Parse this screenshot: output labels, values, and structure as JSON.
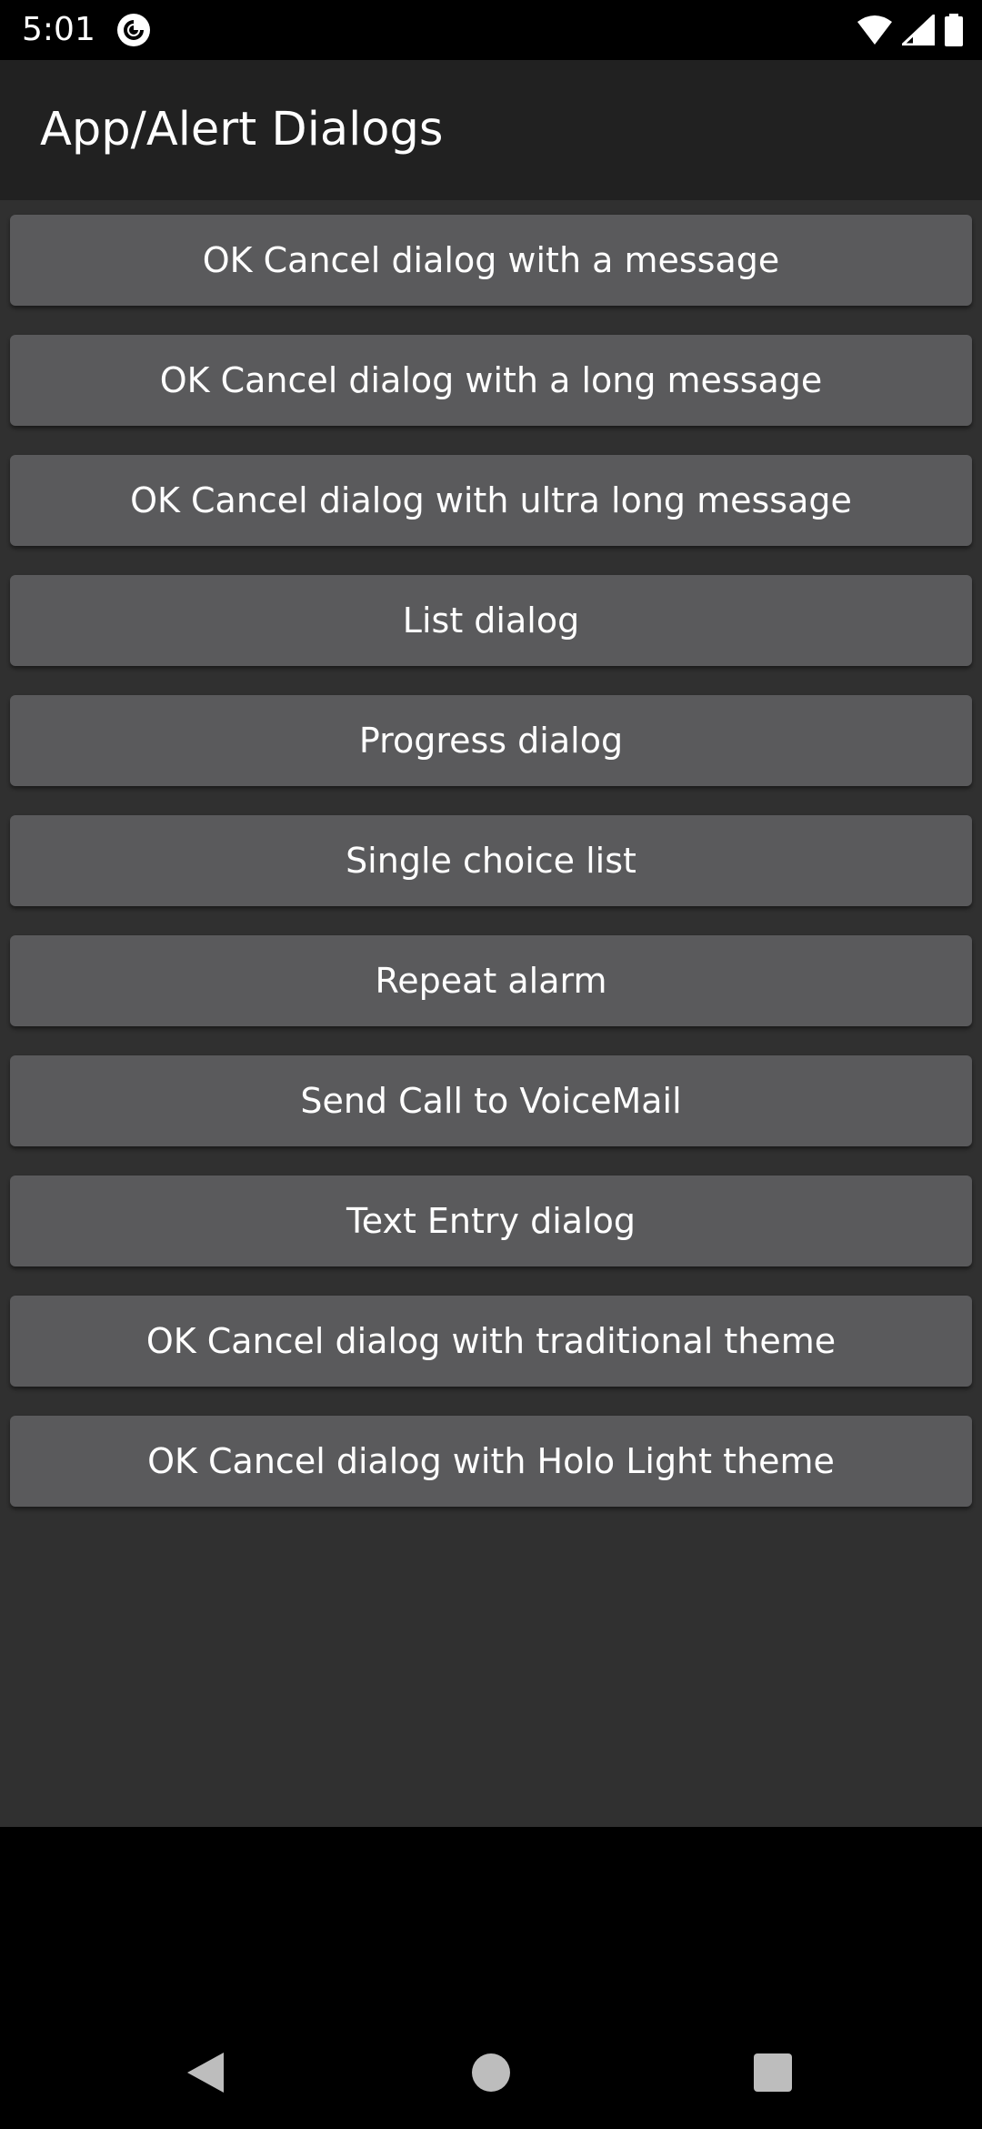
{
  "status_bar": {
    "time": "5:01",
    "app_icon": "pocket-casts-icon",
    "icons": [
      "wifi-icon",
      "cell-signal-icon",
      "battery-icon"
    ]
  },
  "app_bar": {
    "title": "App/Alert Dialogs"
  },
  "buttons": [
    {
      "label": "OK Cancel dialog with a message"
    },
    {
      "label": "OK Cancel dialog with a long message"
    },
    {
      "label": "OK Cancel dialog with ultra long message"
    },
    {
      "label": "List dialog"
    },
    {
      "label": "Progress dialog"
    },
    {
      "label": "Single choice list"
    },
    {
      "label": "Repeat alarm"
    },
    {
      "label": "Send Call to VoiceMail"
    },
    {
      "label": "Text Entry dialog"
    },
    {
      "label": "OK Cancel dialog with traditional theme"
    },
    {
      "label": "OK Cancel dialog with Holo Light theme"
    }
  ],
  "nav_bar": {
    "icons": [
      "back-icon",
      "home-icon",
      "recents-icon"
    ]
  },
  "colors": {
    "status_bar_bg": "#000000",
    "app_bar_bg": "#212121",
    "content_bg": "#303030",
    "button_bg": "#5a5a5c",
    "text": "#ffffff",
    "nav_icon": "#bdbdbd"
  }
}
